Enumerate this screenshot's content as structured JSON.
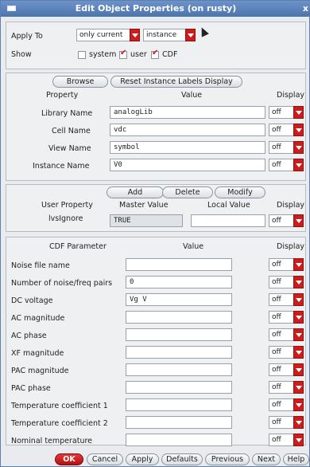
{
  "window": {
    "title": "Edit Object Properties (on rusty)",
    "close_glyph": "x"
  },
  "top": {
    "apply_to_label": "Apply To",
    "apply_to_value": "only current",
    "apply_scope_value": "instance",
    "show_label": "Show",
    "show_system": "system",
    "show_user": "user",
    "show_cdf": "CDF"
  },
  "instance_section": {
    "browse": "Browse",
    "reset": "Reset Instance Labels Display",
    "col_property": "Property",
    "col_value": "Value",
    "col_display": "Display",
    "rows": [
      {
        "label": "Library Name",
        "value": "analogLib",
        "display": "off"
      },
      {
        "label": "Cell Name",
        "value": "vdc",
        "display": "off"
      },
      {
        "label": "View Name",
        "value": "symbol",
        "display": "off"
      },
      {
        "label": "Instance Name",
        "value": "V0",
        "display": "off"
      }
    ]
  },
  "user_section": {
    "add": "Add",
    "delete": "Delete",
    "modify": "Modify",
    "col_user_property": "User Property",
    "col_master_value": "Master Value",
    "col_local_value": "Local Value",
    "col_display": "Display",
    "row": {
      "label": "lvsIgnore",
      "master": "TRUE",
      "local": "",
      "display": "off"
    }
  },
  "cdf_section": {
    "col_parameter": "CDF Parameter",
    "col_value": "Value",
    "col_display": "Display",
    "rows": [
      {
        "label": "Noise file name",
        "value": "",
        "display": "off"
      },
      {
        "label": "Number of noise/freq pairs",
        "value": "0",
        "display": "off"
      },
      {
        "label": "DC voltage",
        "value": "Vg V",
        "display": "off"
      },
      {
        "label": "AC magnitude",
        "value": "",
        "display": "off"
      },
      {
        "label": "AC phase",
        "value": "",
        "display": "off"
      },
      {
        "label": "XF magnitude",
        "value": "",
        "display": "off"
      },
      {
        "label": "PAC magnitude",
        "value": "",
        "display": "off"
      },
      {
        "label": "PAC phase",
        "value": "",
        "display": "off"
      },
      {
        "label": "Temperature coefficient 1",
        "value": "",
        "display": "off"
      },
      {
        "label": "Temperature coefficient 2",
        "value": "",
        "display": "off"
      },
      {
        "label": "Nominal temperature",
        "value": "",
        "display": "off"
      }
    ]
  },
  "footer": {
    "ok": "OK",
    "cancel": "Cancel",
    "apply": "Apply",
    "defaults": "Defaults",
    "previous": "Previous",
    "next": "Next",
    "help": "Help"
  }
}
